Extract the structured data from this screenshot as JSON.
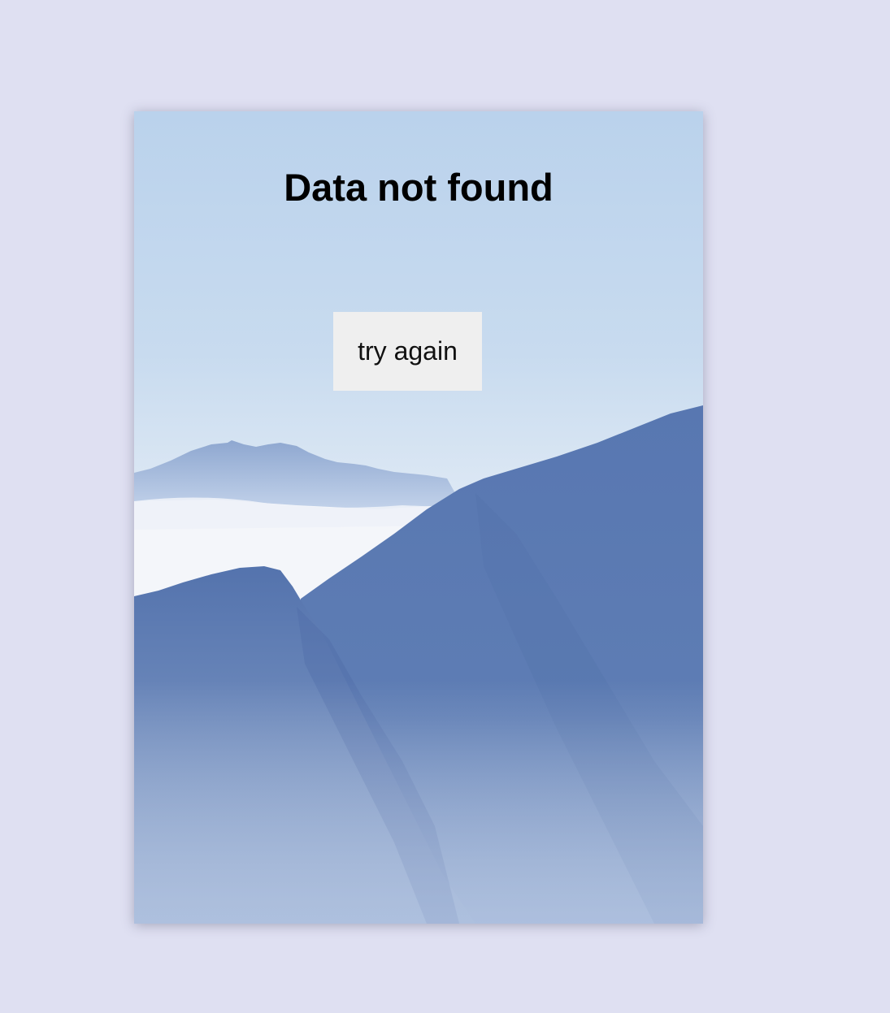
{
  "error": {
    "title": "Data not found",
    "retry_label": "try again"
  },
  "background": {
    "icon": "mountain-landscape-image"
  },
  "colors": {
    "page_bg": "#dfe0f2",
    "sky_top": "#bcd3ec",
    "mountain": "#5a7ab2",
    "button_bg": "#efefef"
  }
}
